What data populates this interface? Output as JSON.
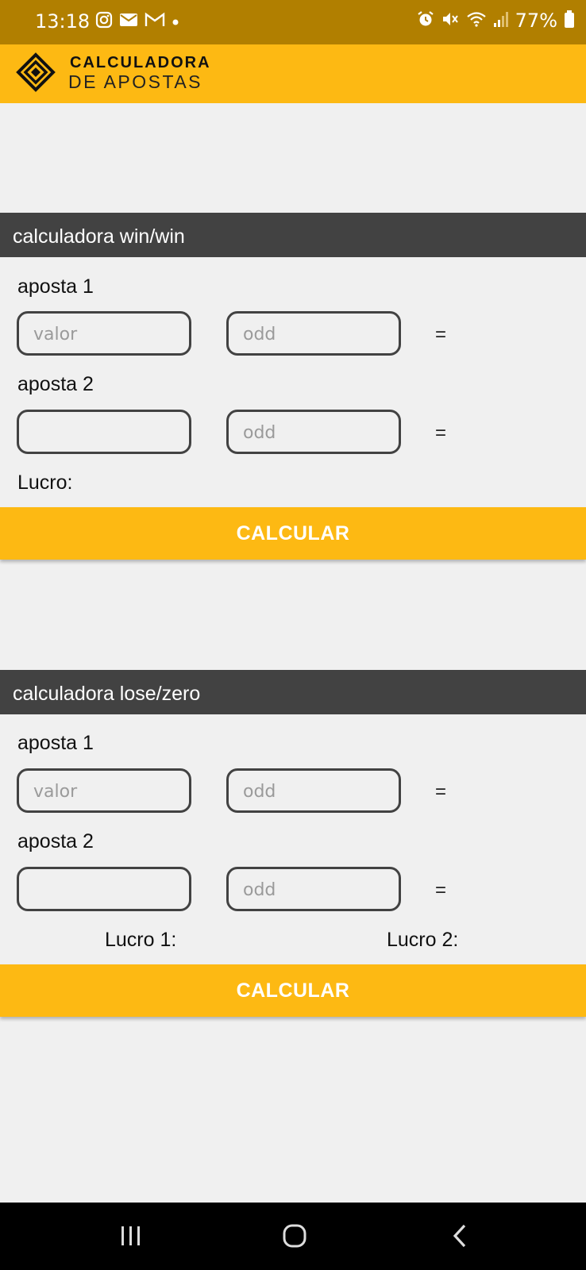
{
  "status_bar": {
    "time": "13:18",
    "battery": "77%",
    "icons_left": [
      "instagram-icon",
      "mail-icon",
      "gmail-icon",
      "dot-icon"
    ],
    "icons_right": [
      "alarm-icon",
      "mute-icon",
      "wifi-icon",
      "signal-icon",
      "battery-icon"
    ]
  },
  "header": {
    "logo_line1": "CALCULADORA",
    "logo_line2": "DE APOSTAS",
    "bg_color": "#fdb913"
  },
  "win_win": {
    "title": "calculadora win/win",
    "bet1_label": "aposta 1",
    "bet1_value_placeholder": "valor",
    "bet1_odd_placeholder": "odd",
    "bet1_eq": "=",
    "bet2_label": "aposta 2",
    "bet2_value": "",
    "bet2_odd_placeholder": "odd",
    "bet2_eq": "=",
    "profit_label": "Lucro:",
    "button": "CALCULAR"
  },
  "lose_zero": {
    "title": "calculadora lose/zero",
    "bet1_label": "aposta 1",
    "bet1_value_placeholder": "valor",
    "bet1_odd_placeholder": "odd",
    "bet1_eq": "=",
    "bet2_label": "aposta 2",
    "bet2_value": "",
    "bet2_odd_placeholder": "odd",
    "bet2_eq": "=",
    "profit1_label": "Lucro 1:",
    "profit2_label": "Lucro 2:",
    "button": "CALCULAR"
  },
  "nav_bar": {
    "buttons": [
      "recents-icon",
      "home-icon",
      "back-icon"
    ]
  }
}
